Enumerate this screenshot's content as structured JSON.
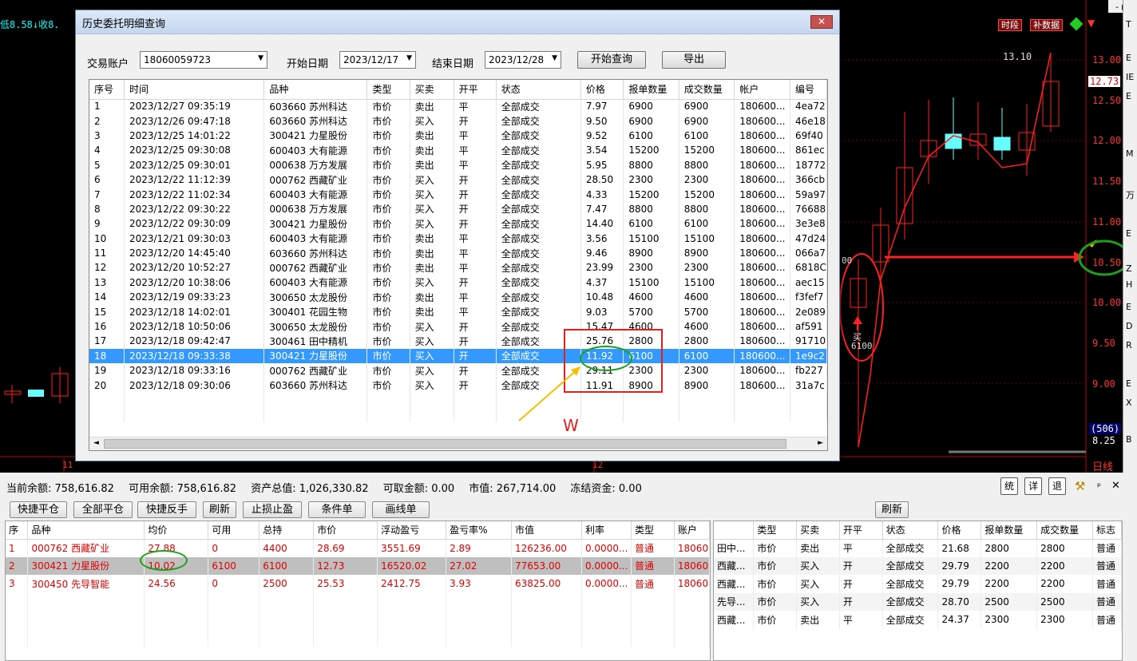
{
  "chart": {
    "top_status": "低8.58↓收8.",
    "btn_shiduan": "时段",
    "btn_bushuju": "补数据",
    "win_ctl": "- 🗗",
    "price_labels": [
      "13.00",
      "12.50",
      "12.00",
      "11.50",
      "11.00",
      "10.50",
      "10.00",
      "9.50",
      "9.00"
    ],
    "current_price": "12.73",
    "highlight_price": "10.50",
    "max_label": "13.10",
    "buy_label": "买",
    "buy_qty": "6100",
    "vol_label": "(506)",
    "low_label": "8.25",
    "period": "日线",
    "date_mark_1": "11",
    "date_mark_2": "12",
    "left_00": "00",
    "right_strip_chars": [
      "T",
      "E",
      "IE",
      "E",
      "M",
      "万",
      "E",
      "Z",
      "I",
      "",
      "B",
      "H",
      "E",
      "D",
      "R",
      "E",
      "X",
      "B"
    ]
  },
  "dialog": {
    "title": "历史委托明细查询",
    "close": "✕",
    "account_label": "交易账户",
    "account_value": "18060059723",
    "start_label": "开始日期",
    "start_value": "2023/12/17",
    "end_label": "结束日期",
    "end_value": "2023/12/28",
    "query_btn": "开始查询",
    "export_btn": "导出",
    "columns": [
      "序号",
      "时间",
      "品种",
      "类型",
      "买卖",
      "开平",
      "状态",
      "价格",
      "报单数量",
      "成交数量",
      "帐户",
      "编号"
    ],
    "rows": [
      [
        "1",
        "2023/12/27 09:35:19",
        "603660 苏州科达",
        "市价",
        "卖出",
        "平",
        "全部成交",
        "7.97",
        "6900",
        "6900",
        "180600...",
        "4ea72"
      ],
      [
        "2",
        "2023/12/26 09:47:18",
        "603660 苏州科达",
        "市价",
        "买入",
        "开",
        "全部成交",
        "9.50",
        "6900",
        "6900",
        "180600...",
        "46e18"
      ],
      [
        "3",
        "2023/12/25 14:01:22",
        "300421 力星股份",
        "市价",
        "卖出",
        "平",
        "全部成交",
        "9.52",
        "6100",
        "6100",
        "180600...",
        "69f40"
      ],
      [
        "4",
        "2023/12/25 09:30:08",
        "600403 大有能源",
        "市价",
        "卖出",
        "平",
        "全部成交",
        "3.54",
        "15200",
        "15200",
        "180600...",
        "861ec"
      ],
      [
        "5",
        "2023/12/25 09:30:01",
        "000638 万方发展",
        "市价",
        "卖出",
        "平",
        "全部成交",
        "5.95",
        "8800",
        "8800",
        "180600...",
        "18772"
      ],
      [
        "6",
        "2023/12/22 11:12:39",
        "000762 西藏矿业",
        "市价",
        "买入",
        "开",
        "全部成交",
        "28.50",
        "2300",
        "2300",
        "180600...",
        "366cb"
      ],
      [
        "7",
        "2023/12/22 11:02:34",
        "600403 大有能源",
        "市价",
        "买入",
        "开",
        "全部成交",
        "4.33",
        "15200",
        "15200",
        "180600...",
        "59a97"
      ],
      [
        "8",
        "2023/12/22 09:30:22",
        "000638 万方发展",
        "市价",
        "买入",
        "开",
        "全部成交",
        "7.47",
        "8800",
        "8800",
        "180600...",
        "76688"
      ],
      [
        "9",
        "2023/12/22 09:30:09",
        "300421 力星股份",
        "市价",
        "买入",
        "开",
        "全部成交",
        "14.40",
        "6100",
        "6100",
        "180600...",
        "3e3e8"
      ],
      [
        "10",
        "2023/12/21 09:30:03",
        "600403 大有能源",
        "市价",
        "卖出",
        "平",
        "全部成交",
        "3.56",
        "15100",
        "15100",
        "180600...",
        "47d24"
      ],
      [
        "11",
        "2023/12/20 14:45:40",
        "603660 苏州科达",
        "市价",
        "卖出",
        "平",
        "全部成交",
        "9.46",
        "8900",
        "8900",
        "180600...",
        "066a7"
      ],
      [
        "12",
        "2023/12/20 10:52:27",
        "000762 西藏矿业",
        "市价",
        "卖出",
        "平",
        "全部成交",
        "23.99",
        "2300",
        "2300",
        "180600...",
        "6818C"
      ],
      [
        "13",
        "2023/12/20 10:38:06",
        "600403 大有能源",
        "市价",
        "买入",
        "开",
        "全部成交",
        "4.37",
        "15100",
        "15100",
        "180600...",
        "aec15"
      ],
      [
        "14",
        "2023/12/19 09:33:23",
        "300650 太龙股份",
        "市价",
        "卖出",
        "平",
        "全部成交",
        "10.48",
        "4600",
        "4600",
        "180600...",
        "f3fef7"
      ],
      [
        "15",
        "2023/12/18 14:02:01",
        "300401 花园生物",
        "市价",
        "卖出",
        "平",
        "全部成交",
        "9.03",
        "5700",
        "5700",
        "180600...",
        "2e089"
      ],
      [
        "16",
        "2023/12/18 10:50:06",
        "300650 太龙股份",
        "市价",
        "买入",
        "开",
        "全部成交",
        "15.47",
        "4600",
        "4600",
        "180600...",
        "af591"
      ],
      [
        "17",
        "2023/12/18 09:42:47",
        "300461 田中精机",
        "市价",
        "买入",
        "开",
        "全部成交",
        "25.76",
        "2800",
        "2800",
        "180600...",
        "91710"
      ],
      [
        "18",
        "2023/12/18 09:33:38",
        "300421 力星股份",
        "市价",
        "买入",
        "开",
        "全部成交",
        "11.92",
        "6100",
        "6100",
        "180600...",
        "1e9c2"
      ],
      [
        "19",
        "2023/12/18 09:33:16",
        "000762 西藏矿业",
        "市价",
        "买入",
        "开",
        "全部成交",
        "29.11",
        "2300",
        "2300",
        "180600...",
        "fb227"
      ],
      [
        "20",
        "2023/12/18 09:30:06",
        "603660 苏州科达",
        "市价",
        "买入",
        "开",
        "全部成交",
        "11.91",
        "8900",
        "8900",
        "180600...",
        "31a7c"
      ]
    ],
    "selected_row": 17,
    "annotation_w": "W"
  },
  "account": {
    "balance": "当前余额: 758,616.82",
    "available": "可用余额: 758,616.82",
    "total": "资产总值: 1,026,330.82",
    "withdrawable": "可取金额: 0.00",
    "market_value": "市值: 267,714.00",
    "frozen": "冻结资金: 0.00",
    "icons": [
      "统",
      "详",
      "退",
      "⚒",
      "ᵖ",
      "✕"
    ]
  },
  "toolbar": [
    "快捷平仓",
    "全部平仓",
    "快捷反手",
    "刷新",
    "止损止盈",
    "条件单",
    "画线单"
  ],
  "refresh_right": "刷新",
  "positions": {
    "columns": [
      "序",
      "品种",
      "均价",
      "可用",
      "总持",
      "市价",
      "浮动盈亏",
      "盈亏率%",
      "市值",
      "利率",
      "类型",
      "账户"
    ],
    "rows": [
      [
        "1",
        "000762 西藏矿业",
        "27.88",
        "0",
        "4400",
        "28.69",
        "3551.69",
        "2.89",
        "126236.00",
        "0.0000...",
        "普通",
        "18060"
      ],
      [
        "2",
        "300421 力星股份",
        "10.02",
        "6100",
        "6100",
        "12.73",
        "16520.02",
        "27.02",
        "77653.00",
        "0.0000...",
        "普通",
        "18060"
      ],
      [
        "3",
        "300450 先导智能",
        "24.56",
        "0",
        "2500",
        "25.53",
        "2412.75",
        "3.93",
        "63825.00",
        "0.0000...",
        "普通",
        "18060"
      ]
    ]
  },
  "orders": {
    "columns": [
      "",
      "类型",
      "买卖",
      "开平",
      "状态",
      "价格",
      "报单数量",
      "成交数量",
      "标志"
    ],
    "rows": [
      [
        "田中...",
        "市价",
        "卖出",
        "平",
        "全部成交",
        "21.68",
        "2800",
        "2800",
        "普通"
      ],
      [
        "西藏...",
        "市价",
        "买入",
        "开",
        "全部成交",
        "29.79",
        "2200",
        "2200",
        "普通"
      ],
      [
        "西藏...",
        "市价",
        "买入",
        "开",
        "全部成交",
        "29.79",
        "2200",
        "2200",
        "普通"
      ],
      [
        "先导...",
        "市价",
        "买入",
        "开",
        "全部成交",
        "28.70",
        "2500",
        "2500",
        "普通"
      ],
      [
        "西藏...",
        "市价",
        "卖出",
        "平",
        "全部成交",
        "24.37",
        "2300",
        "2300",
        "普通"
      ]
    ]
  }
}
